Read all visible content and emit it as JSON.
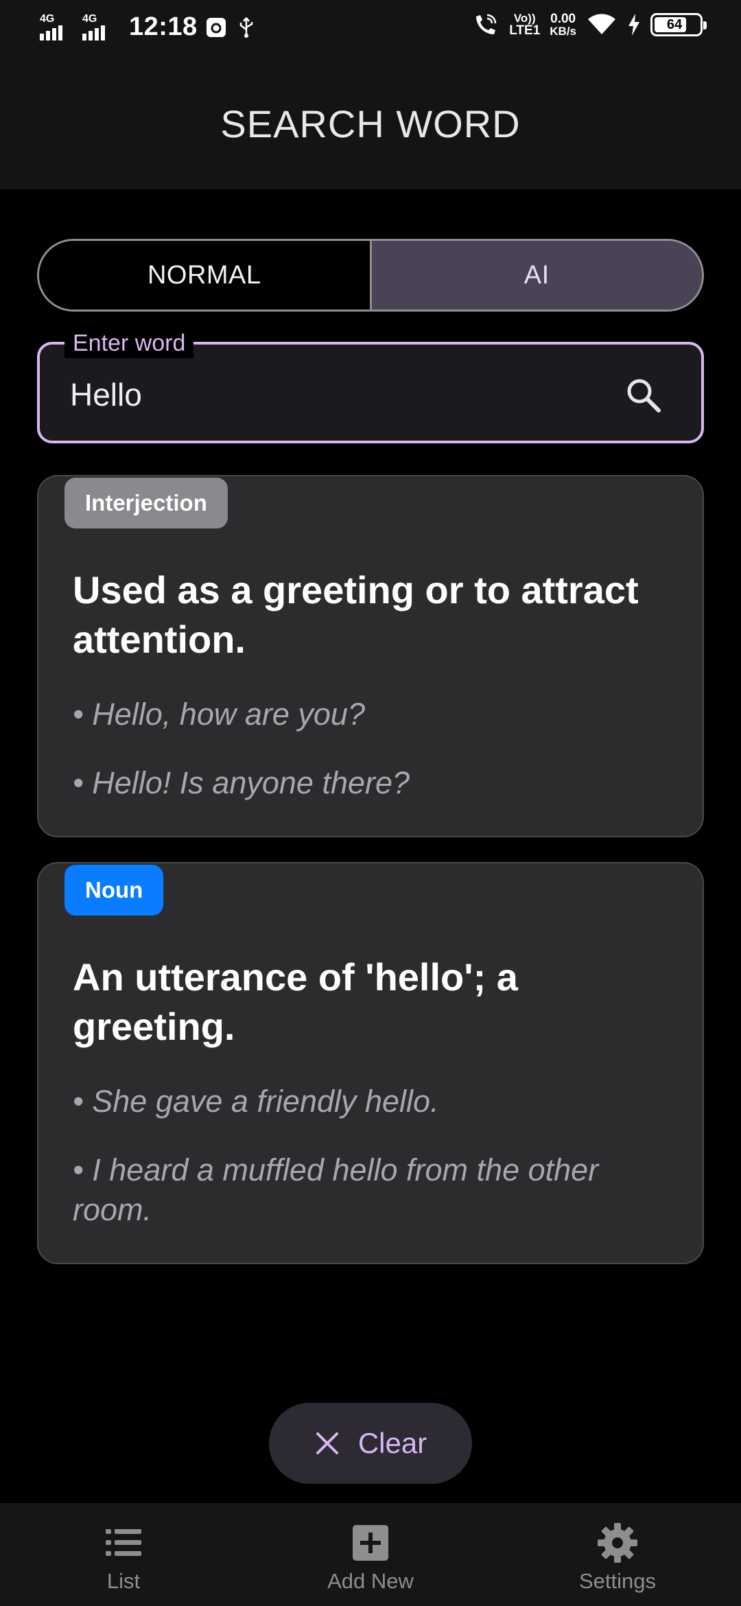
{
  "status_bar": {
    "network1": "4G",
    "network2": "4G",
    "time": "12:18",
    "volte_top": "Vo))",
    "volte_bottom": "LTE1",
    "speed_value": "0.00",
    "speed_unit": "KB/s",
    "battery": "64",
    "icons": [
      "wifi-call-icon",
      "wifi-icon",
      "charging-icon",
      "usb-icon",
      "app-notification-icon"
    ]
  },
  "app_bar": {
    "title": "SEARCH WORD"
  },
  "mode_toggle": {
    "normal_label": "NORMAL",
    "ai_label": "AI",
    "selected": "AI"
  },
  "search": {
    "label": "Enter word",
    "value": "Hello"
  },
  "results": [
    {
      "part_of_speech": "Interjection",
      "badge_color": "#8a8a8e",
      "definition": "Used as a greeting or to attract attention.",
      "examples": [
        "• Hello, how are you?",
        "• Hello! Is anyone there?"
      ]
    },
    {
      "part_of_speech": "Noun",
      "badge_color": "#0a7cff",
      "definition": "An utterance of 'hello'; a greeting.",
      "examples": [
        "• She gave a friendly hello.",
        "• I heard a muffled hello from the other room."
      ]
    }
  ],
  "clear_button": {
    "label": "Clear"
  },
  "bottom_nav": {
    "items": [
      {
        "label": "List",
        "icon": "list-icon"
      },
      {
        "label": "Add New",
        "icon": "add-box-icon"
      },
      {
        "label": "Settings",
        "icon": "gear-icon"
      }
    ]
  },
  "colors": {
    "accent": "#d8b6f2",
    "toggle_selected_bg": "#4a4356",
    "card_bg": "#2c2c2e"
  }
}
